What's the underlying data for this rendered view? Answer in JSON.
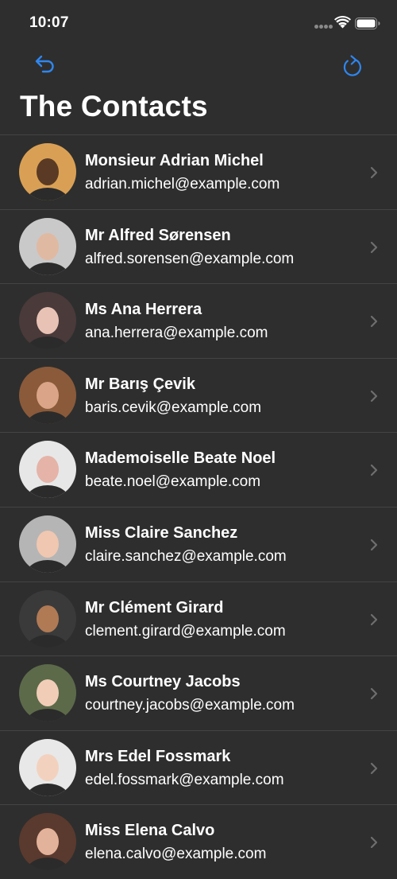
{
  "status_bar": {
    "time": "10:07",
    "icons": [
      "signal-dots-icon",
      "wifi-icon",
      "battery-icon"
    ]
  },
  "nav": {
    "back_icon": "undo-arrow-icon",
    "refresh_icon": "refresh-icon",
    "accent_color": "#2f86ee"
  },
  "title": "The Contacts",
  "contacts": [
    {
      "name": "Monsieur Adrian Michel",
      "email": "adrian.michel@example.com",
      "avatar_bg": "#d9a055",
      "avatar_fg": "#5a3a24"
    },
    {
      "name": "Mr Alfred Sørensen",
      "email": "alfred.sorensen@example.com",
      "avatar_bg": "#c9c9c9",
      "avatar_fg": "#e0b9a2"
    },
    {
      "name": "Ms Ana Herrera",
      "email": "ana.herrera@example.com",
      "avatar_bg": "#4a3a3a",
      "avatar_fg": "#e8c3b5"
    },
    {
      "name": "Mr Barış Çevik",
      "email": "baris.cevik@example.com",
      "avatar_bg": "#8a5a3a",
      "avatar_fg": "#d9a487"
    },
    {
      "name": "Mademoiselle Beate Noel",
      "email": "beate.noel@example.com",
      "avatar_bg": "#e7e7e7",
      "avatar_fg": "#e5b3a8"
    },
    {
      "name": "Miss Claire Sanchez",
      "email": "claire.sanchez@example.com",
      "avatar_bg": "#b5b5b5",
      "avatar_fg": "#f0c7b0"
    },
    {
      "name": "Mr Clément Girard",
      "email": "clement.girard@example.com",
      "avatar_bg": "#3a3a3a",
      "avatar_fg": "#b07a55"
    },
    {
      "name": "Ms Courtney Jacobs",
      "email": "courtney.jacobs@example.com",
      "avatar_bg": "#5c6a4a",
      "avatar_fg": "#f1cdb8"
    },
    {
      "name": "Mrs Edel Fossmark",
      "email": "edel.fossmark@example.com",
      "avatar_bg": "#e8e8e8",
      "avatar_fg": "#f2d2bf"
    },
    {
      "name": "Miss Elena Calvo",
      "email": "elena.calvo@example.com",
      "avatar_bg": "#5a3a2e",
      "avatar_fg": "#e3b29a"
    }
  ],
  "chevron_icon": "chevron-right-icon"
}
